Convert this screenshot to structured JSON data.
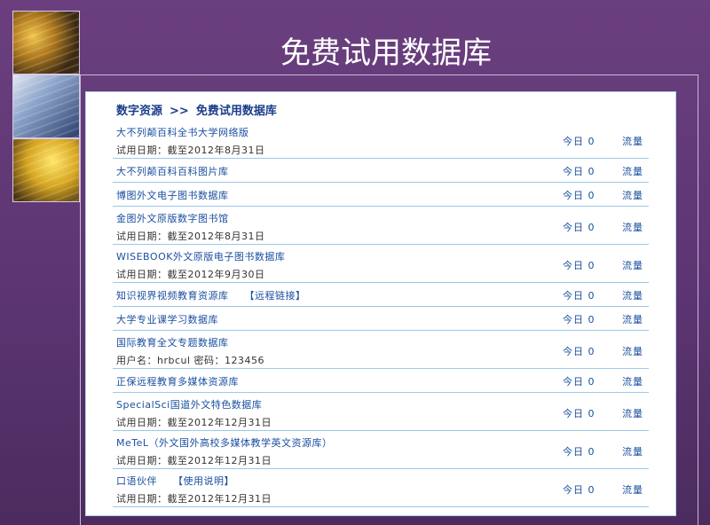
{
  "slide_title": "免费试用数据库",
  "breadcrumb": {
    "parent": "数字资源",
    "separator": ">>",
    "current": "免费试用数据库"
  },
  "items": [
    {
      "title": "大不列颠百科全书大学网络版",
      "link": "",
      "sub": "试用日期：截至2012年8月31日",
      "today": "今日 0",
      "flow": "流量"
    },
    {
      "title": "大不列颠百科百科图片库",
      "link": "",
      "sub": "",
      "today": "今日 0",
      "flow": "流量"
    },
    {
      "title": "博图外文电子图书数据库",
      "link": "",
      "sub": "",
      "today": "今日 0",
      "flow": "流量"
    },
    {
      "title": "金图外文原版数字图书馆",
      "link": "",
      "sub": "试用日期：截至2012年8月31日",
      "today": "今日 0",
      "flow": "流量"
    },
    {
      "title": "WISEBOOK外文原版电子图书数据库",
      "link": "",
      "sub": "试用日期：截至2012年9月30日",
      "today": "今日 0",
      "flow": "流量"
    },
    {
      "title": "知识视界视频教育资源库",
      "link": "【远程链接】",
      "sub": "",
      "today": "今日 0",
      "flow": "流量"
    },
    {
      "title": "大学专业课学习数据库",
      "link": "",
      "sub": "",
      "today": "今日 0",
      "flow": "流量"
    },
    {
      "title": "国际教育全文专题数据库",
      "link": "",
      "sub": "用户名：hrbcul 密码：123456",
      "today": "今日 0",
      "flow": "流量"
    },
    {
      "title": "正保远程教育多媒体资源库",
      "link": "",
      "sub": "",
      "today": "今日 0",
      "flow": "流量"
    },
    {
      "title": "SpecialSci国道外文特色数据库",
      "link": "",
      "sub": "试用日期：截至2012年12月31日",
      "today": "今日 0",
      "flow": "流量"
    },
    {
      "title": "MeTeL（外文国外高校多媒体教学英文资源库）",
      "link": "",
      "sub": "试用日期：截至2012年12月31日",
      "today": "今日 0",
      "flow": "流量"
    },
    {
      "title": "口语伙伴",
      "link": "【使用说明】",
      "sub": "试用日期：截至2012年12月31日",
      "today": "今日 0",
      "flow": "流量"
    }
  ]
}
